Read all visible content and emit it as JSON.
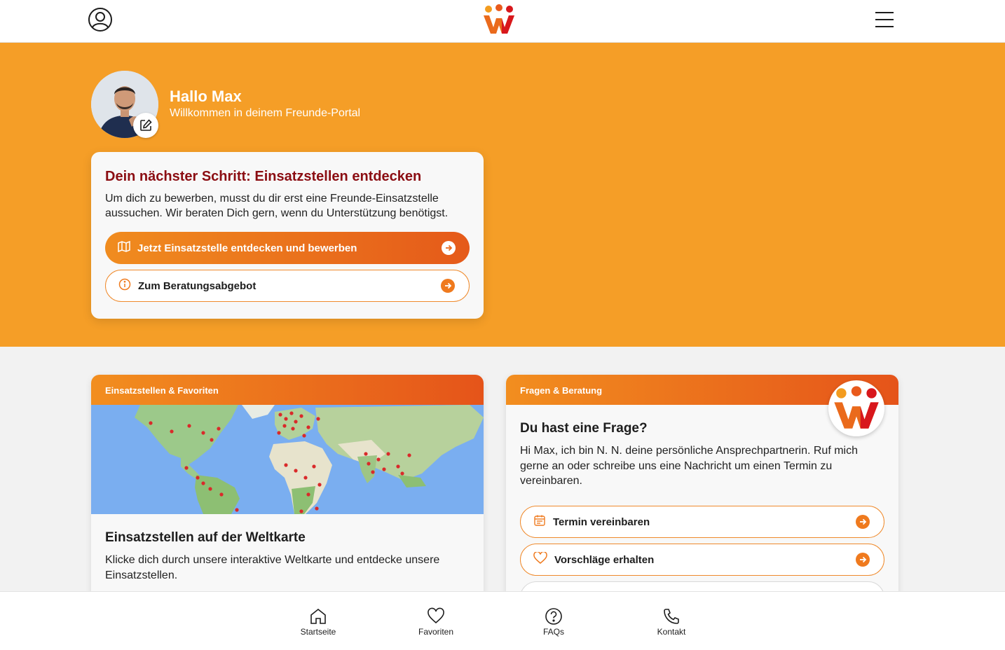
{
  "header": {
    "user_icon": "user-circle-icon",
    "logo": "freunde-logo",
    "menu_icon": "hamburger-menu-icon"
  },
  "hero": {
    "greeting": "Hallo Max",
    "welcome": "Willkommen in deinem Freunde-Portal",
    "edit_icon": "edit-icon"
  },
  "next_step": {
    "title": "Dein nächster Schritt: Einsatzstellen entdecken",
    "text": "Um dich zu bewerben, musst du dir erst eine Freunde-Einsatzstelle aussuchen. Wir beraten Dich gern, wenn du Unterstützung benötigst.",
    "primary_label": "Jetzt Einsatzstelle entdecken und bewerben",
    "primary_icon": "map-icon",
    "secondary_label": "Zum Beratungsabgebot",
    "secondary_icon": "info-icon"
  },
  "places_card": {
    "header": "Einsatzstellen & Favoriten",
    "title": "Einsatzstellen auf der Weltkarte",
    "text": "Klicke dich durch unsere interaktive Weltkarte und entdecke unsere Einsatzstellen."
  },
  "advice_card": {
    "header": "Fragen & Beratung",
    "title": "Du hast eine Frage?",
    "text": "Hi Max, ich bin N. N. deine persönliche Ansprechpartnerin. Ruf mich gerne an oder schreibe uns eine Nachricht um einen Termin zu vereinbaren.",
    "appointment_label": "Termin vereinbaren",
    "appointment_icon": "calendar-icon",
    "suggestions_label": "Vorschläge erhalten",
    "suggestions_icon": "heart-icon"
  },
  "nav": {
    "items": [
      {
        "label": "Startseite",
        "icon": "home-icon"
      },
      {
        "label": "Favoriten",
        "icon": "heart-icon"
      },
      {
        "label": "FAQs",
        "icon": "question-icon"
      },
      {
        "label": "Kontakt",
        "icon": "phone-icon"
      }
    ]
  },
  "colors": {
    "hero_orange": "#f59e27",
    "accent_orange": "#ef7a1e",
    "title_red": "#8b0d12"
  }
}
